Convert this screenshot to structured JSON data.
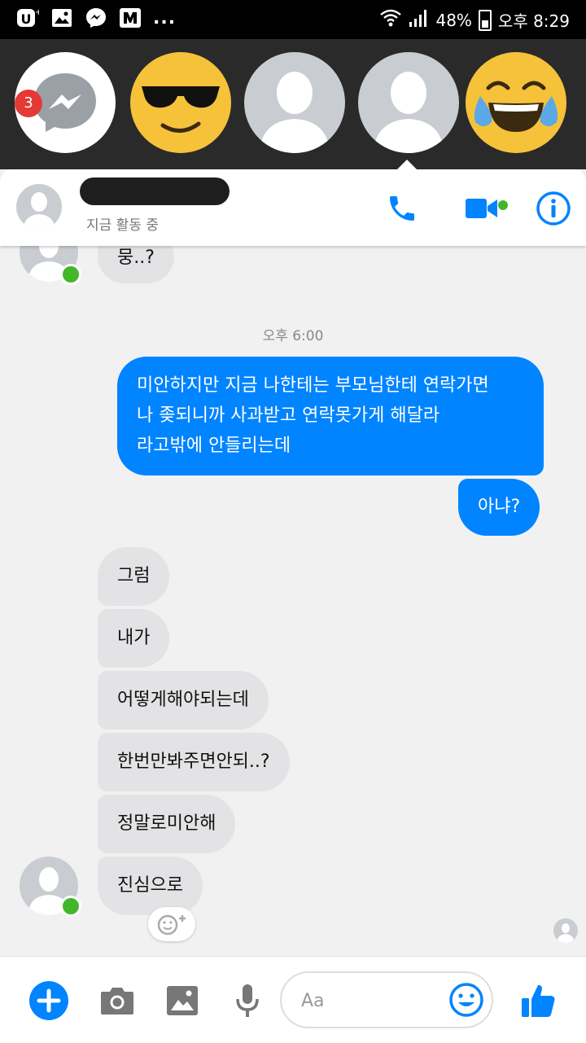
{
  "status_bar": {
    "battery": "48%",
    "time": "오후 8:29",
    "dots": "..."
  },
  "chat_heads": {
    "badge_count": "3"
  },
  "header": {
    "status": "지금 활동 중"
  },
  "conversation": {
    "top_message": "뭉..?",
    "timestamp": "오후 6:00",
    "sent_message": {
      "line1": "미안하지만 지금 나한테는 부모님한테 연락가면",
      "line2": "나 좆되니까 사과받고 연락못가게 해달라",
      "line3": "라고밖에 안들리는데"
    },
    "sent_short": "아냐?",
    "received": [
      "그럼",
      "내가",
      "어떻게해야되는데",
      "한번만봐주면안되..?",
      "정말로미안해",
      "진심으로"
    ]
  },
  "composer": {
    "placeholder": "Aa"
  },
  "colors": {
    "accent": "#0084ff",
    "online": "#42b72a",
    "incoming_bubble": "#e3e3e5"
  },
  "icons": [
    "u-plus-icon",
    "gallery-icon",
    "messenger-icon",
    "mnet-icon",
    "wifi-icon",
    "signal-icon",
    "battery-icon",
    "phone-icon",
    "video-icon",
    "info-icon",
    "plus-icon",
    "camera-icon",
    "image-icon",
    "microphone-icon",
    "emoji-icon",
    "thumbs-up-icon"
  ]
}
